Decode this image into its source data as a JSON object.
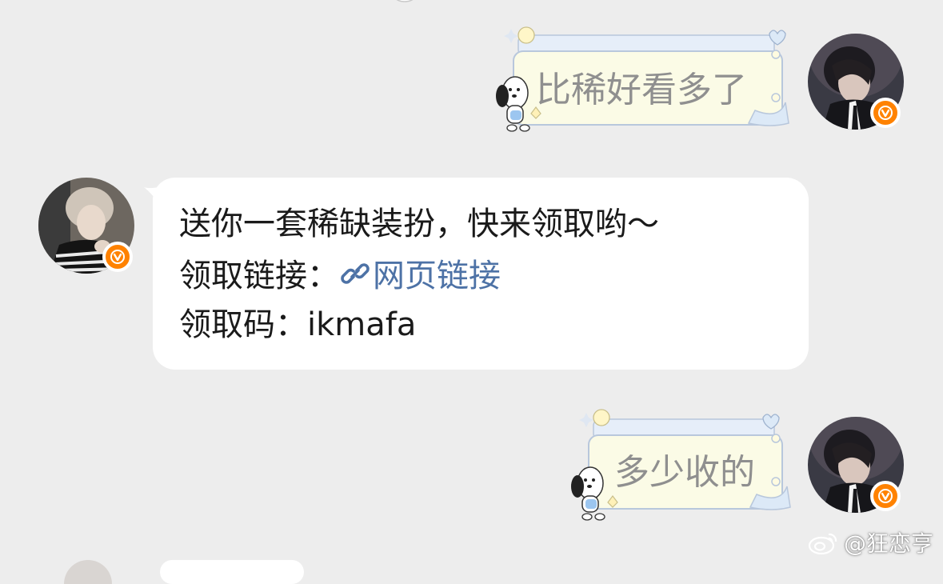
{
  "messages": {
    "sent_1": {
      "text": "比稀好看多了"
    },
    "received_1": {
      "line_1": "送你一套稀缺装扮，快来领取哟～",
      "line_2_label": "领取链接：",
      "link_text": "网页链接",
      "line_3": "领取码：ikmafa"
    },
    "sent_2": {
      "text": "多少收的"
    }
  },
  "watermark": {
    "text": "@狂恋亨"
  },
  "icons": {
    "verified_badge": "verified-v-icon",
    "link": "link-chain-icon",
    "weibo": "weibo-logo-icon"
  },
  "colors": {
    "background": "#ededed",
    "bubble": "#ffffff",
    "link": "#4d72a6",
    "verified_badge": "#ff8200",
    "deco_frame": "#dce9f7",
    "deco_fill": "#fbfbe6"
  }
}
